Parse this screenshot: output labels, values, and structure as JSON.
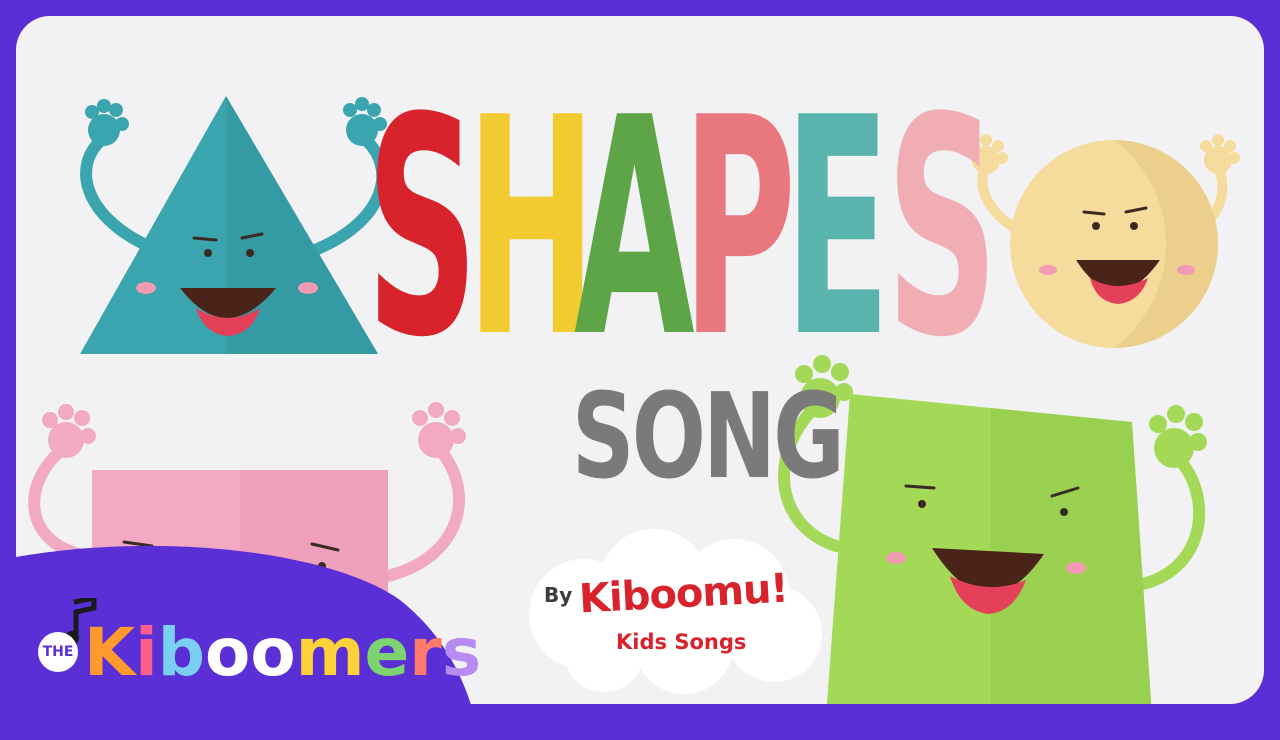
{
  "title": {
    "letters": [
      {
        "char": "S",
        "color": "#d8232d"
      },
      {
        "char": "H",
        "color": "#f2cb31"
      },
      {
        "char": "A",
        "color": "#5ea548"
      },
      {
        "char": "P",
        "color": "#e8777e"
      },
      {
        "char": "E",
        "color": "#58b4ac"
      },
      {
        "char": "S",
        "color": "#f0adb4"
      }
    ],
    "subtitle": "SONG"
  },
  "credit": {
    "by": "By",
    "brand": "Kiboomu!",
    "sub": "Kids Songs"
  },
  "badge": {
    "the": "THE",
    "letters": [
      {
        "char": "K",
        "color": "#ff9a2e"
      },
      {
        "char": "i",
        "color": "#ff5f8f"
      },
      {
        "char": "b",
        "color": "#7ad0f2"
      },
      {
        "char": "o",
        "color": "#ffffff"
      },
      {
        "char": "o",
        "color": "#ffffff"
      },
      {
        "char": "m",
        "color": "#ffd23a"
      },
      {
        "char": "e",
        "color": "#7cd36f"
      },
      {
        "char": "r",
        "color": "#ff7a6b"
      },
      {
        "char": "s",
        "color": "#b68cf2"
      }
    ]
  },
  "colors": {
    "frame": "#5b2fd6",
    "background": "#f2f2f4",
    "triangle": "#3aa5ae",
    "circle": "#f5dc9c",
    "square": "#f2a9c4",
    "rectangle": "#a3d957"
  }
}
